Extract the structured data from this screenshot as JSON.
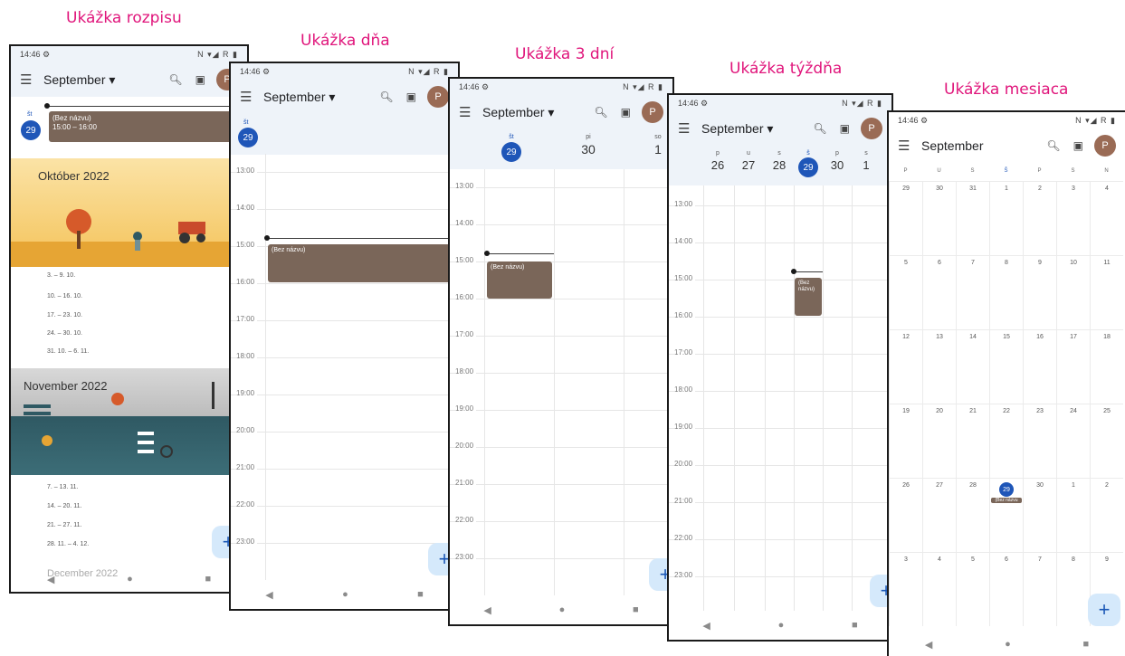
{
  "captions": {
    "schedule": "Ukážka rozpisu",
    "day": "Ukážka dňa",
    "three_day": "Ukážka 3 dní",
    "week": "Ukážka týždňa",
    "month": "Ukážka mesiaca"
  },
  "status": {
    "time": "14:46",
    "icons": "N ▾◢ R ▮"
  },
  "app": {
    "month_label": "September ▾",
    "month_plain": "September",
    "avatar_letter": "P"
  },
  "hours": [
    "13:00",
    "14:00",
    "15:00",
    "16:00",
    "17:00",
    "18:00",
    "19:00",
    "20:00",
    "21:00",
    "22:00",
    "23:00"
  ],
  "schedule": {
    "today_weekday": "št",
    "today_day": "29",
    "event_title": "(Bez názvu)",
    "event_time": "15:00 – 16:00",
    "october_title": "Október 2022",
    "october_weeks": [
      "3. – 9. 10.",
      "10. – 16. 10.",
      "17. – 23. 10.",
      "24. – 30. 10.",
      "31. 10. – 6. 11."
    ],
    "november_title": "November 2022",
    "november_weeks": [
      "7. – 13. 11.",
      "14. – 20. 11.",
      "21. – 27. 11.",
      "28. 11. – 4. 12."
    ],
    "december_title": "December 2022"
  },
  "day": {
    "weekday": "št",
    "day": "29",
    "event_title": "(Bez názvu)"
  },
  "three_day": {
    "days": [
      {
        "weekday": "št",
        "day": "29"
      },
      {
        "weekday": "pi",
        "day": "30"
      },
      {
        "weekday": "so",
        "day": "1"
      }
    ],
    "event_title": "(Bez názvu)"
  },
  "week": {
    "days": [
      {
        "weekday": "p",
        "day": "26"
      },
      {
        "weekday": "u",
        "day": "27"
      },
      {
        "weekday": "s",
        "day": "28"
      },
      {
        "weekday": "š",
        "day": "29"
      },
      {
        "weekday": "p",
        "day": "30"
      },
      {
        "weekday": "s",
        "day": "1"
      }
    ],
    "event_title": "(Bez názvu)"
  },
  "month": {
    "weekdays": [
      "P",
      "U",
      "S",
      "Š",
      "P",
      "S",
      "N"
    ],
    "weeks": [
      [
        "29",
        "30",
        "31",
        "1",
        "2",
        "3",
        "4"
      ],
      [
        "5",
        "6",
        "7",
        "8",
        "9",
        "10",
        "11"
      ],
      [
        "12",
        "13",
        "14",
        "15",
        "16",
        "17",
        "18"
      ],
      [
        "19",
        "20",
        "21",
        "22",
        "23",
        "24",
        "25"
      ],
      [
        "26",
        "27",
        "28",
        "29",
        "30",
        "1",
        "2"
      ],
      [
        "3",
        "4",
        "5",
        "6",
        "7",
        "8",
        "9"
      ]
    ],
    "event_label": "(Bez názvu"
  },
  "nav": {
    "back": "◀",
    "home": "●",
    "recents": "■"
  },
  "fab_label": "+",
  "colors": {
    "accent": "#1f56b8",
    "event": "#7a6659",
    "caption": "#e0157b"
  }
}
